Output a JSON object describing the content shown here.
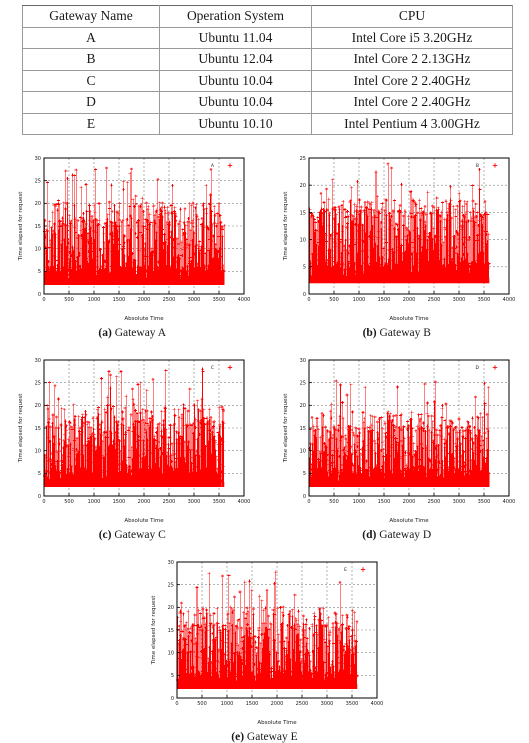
{
  "table": {
    "headers": [
      "Gateway Name",
      "Operation System",
      "CPU"
    ],
    "rows": [
      [
        "A",
        "Ubuntu 11.04",
        "Intel Core i5 3.20GHz"
      ],
      [
        "B",
        "Ubuntu 12.04",
        "Intel Core 2 2.13GHz"
      ],
      [
        "C",
        "Ubuntu 10.04",
        "Intel Core 2 2.40GHz"
      ],
      [
        "D",
        "Ubuntu 10.04",
        "Intel Core 2 2.40GHz"
      ],
      [
        "E",
        "Ubuntu 10.10",
        "Intel Pentium 4 3.00GHz"
      ]
    ]
  },
  "figures": [
    {
      "tag": "(a)",
      "caption_label": "Gateway A",
      "legend": "A"
    },
    {
      "tag": "(b)",
      "caption_label": "Gateway B",
      "legend": "B"
    },
    {
      "tag": "(c)",
      "caption_label": "Gateway C",
      "legend": "C"
    },
    {
      "tag": "(d)",
      "caption_label": "Gateway D",
      "legend": "D"
    },
    {
      "tag": "(e)",
      "caption_label": "Gateway E",
      "legend": "E"
    }
  ],
  "colors": {
    "series": "#ff0000",
    "frame": "#000000",
    "grid": "#808080",
    "text": "#1a1a1a"
  },
  "chart_data": [
    {
      "type": "scatter",
      "title": "",
      "subtitle": "Gateway A",
      "legend_entries": [
        "A"
      ],
      "legend_position": "top-right",
      "grid": true,
      "xlabel": "Absolute Time",
      "ylabel": "Time elapsed for request",
      "xlim": [
        0,
        4000
      ],
      "ylim": [
        0,
        30
      ],
      "xticks": [
        0,
        500,
        1000,
        1500,
        2000,
        2500,
        3000,
        3500,
        4000
      ],
      "yticks": [
        0,
        5,
        10,
        15,
        20,
        25,
        30
      ],
      "n_points": 760,
      "x_data_range": [
        10,
        3600
      ],
      "y_baseline": 2,
      "y_typical_band": [
        3,
        16
      ],
      "y_max_observed": 28,
      "seed": 1101
    },
    {
      "type": "scatter",
      "title": "",
      "subtitle": "Gateway B",
      "legend_entries": [
        "B"
      ],
      "legend_position": "top-right",
      "grid": true,
      "xlabel": "Absolute Time",
      "ylabel": "Time elapsed for request",
      "xlim": [
        0,
        4000
      ],
      "ylim": [
        0,
        25
      ],
      "xticks": [
        0,
        500,
        1000,
        1500,
        2000,
        2500,
        3000,
        3500,
        4000
      ],
      "yticks": [
        0,
        5,
        10,
        15,
        20,
        25
      ],
      "n_points": 760,
      "x_data_range": [
        10,
        3600
      ],
      "y_baseline": 2,
      "y_typical_band": [
        3,
        15
      ],
      "y_max_observed": 24,
      "seed": 1204
    },
    {
      "type": "scatter",
      "title": "",
      "subtitle": "Gateway C",
      "legend_entries": [
        "C"
      ],
      "legend_position": "top-right",
      "grid": true,
      "xlabel": "Absolute Time",
      "ylabel": "Time elapsed for request",
      "xlim": [
        0,
        4000
      ],
      "ylim": [
        0,
        30
      ],
      "xticks": [
        0,
        500,
        1000,
        1500,
        2000,
        2500,
        3000,
        3500,
        4000
      ],
      "yticks": [
        0,
        5,
        10,
        15,
        20,
        25,
        30
      ],
      "n_points": 760,
      "x_data_range": [
        10,
        3600
      ],
      "y_baseline": 2,
      "y_typical_band": [
        3,
        16
      ],
      "y_max_observed": 28,
      "seed": 1004
    },
    {
      "type": "scatter",
      "title": "",
      "subtitle": "Gateway D",
      "legend_entries": [
        "D"
      ],
      "legend_position": "top-right",
      "grid": true,
      "xlabel": "Absolute Time",
      "ylabel": "Time elapsed for request",
      "xlim": [
        0,
        4000
      ],
      "ylim": [
        0,
        30
      ],
      "xticks": [
        0,
        500,
        1000,
        1500,
        2000,
        2500,
        3000,
        3500,
        4000
      ],
      "yticks": [
        0,
        5,
        10,
        15,
        20,
        25,
        30
      ],
      "n_points": 760,
      "x_data_range": [
        10,
        3600
      ],
      "y_baseline": 2,
      "y_typical_band": [
        3,
        15
      ],
      "y_max_observed": 26,
      "seed": 1005
    },
    {
      "type": "scatter",
      "title": "",
      "subtitle": "Gateway E",
      "legend_entries": [
        "E"
      ],
      "legend_position": "top-right",
      "grid": true,
      "xlabel": "Absolute Time",
      "ylabel": "Time elapsed for request",
      "xlim": [
        0,
        4000
      ],
      "ylim": [
        0,
        30
      ],
      "xticks": [
        0,
        500,
        1000,
        1500,
        2000,
        2500,
        3000,
        3500,
        4000
      ],
      "yticks": [
        0,
        5,
        10,
        15,
        20,
        25,
        30
      ],
      "n_points": 760,
      "x_data_range": [
        10,
        3600
      ],
      "y_baseline": 2,
      "y_typical_band": [
        3,
        16
      ],
      "y_max_observed": 28,
      "seed": 1010
    }
  ]
}
